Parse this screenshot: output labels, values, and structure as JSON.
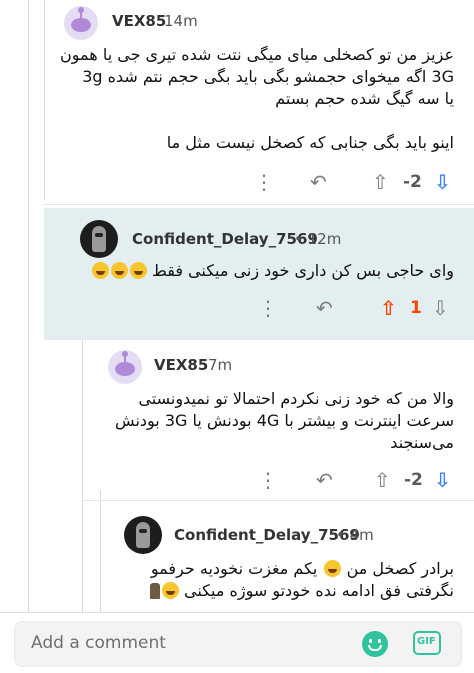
{
  "comments": [
    {
      "username": "VEX85",
      "time": "14m",
      "body_lines": [
        "عزیز من تو کصخلی میای میگی نتت شده تیری جی یا همون",
        "3G اگه میخوای حجمشو بگی باید بگی حجم نتم شده 3g",
        "یا سه گیگ شده حجم بستم",
        "",
        "اینو باید بگی جنابی که کصخل نیست مثل ما"
      ],
      "score": "-2",
      "avatar": "snoo-avatar-purple"
    },
    {
      "username": "Confident_Delay_7569",
      "time": "12m",
      "body_lines": [
        "وای حاجی بس کن داری خود زنی میکنی فقط"
      ],
      "emoji_count": 3,
      "score": "1",
      "highlighted": true,
      "avatar": "dark-ghost-avatar"
    },
    {
      "username": "VEX85",
      "time": "7m",
      "body_lines": [
        "والا من که خود زنی نکردم احتمالا تو نمیدونستی",
        "سرعت اینترنت و بیشتر با 4G بودنش یا 3G بودنش",
        "می‌سنجند"
      ],
      "score": "-2",
      "avatar": "snoo-avatar-purple"
    },
    {
      "username": "Confident_Delay_7569",
      "time": "4m",
      "body_lines": [
        "برادر کصخل من",
        "یکم مغزت نخودیه حرفمو",
        "نگرفتی فق ادامه نده خودتو سوژه میکنی"
      ],
      "avatar": "dark-ghost-avatar"
    }
  ],
  "actions": {
    "more": "⋮",
    "reply": "↶",
    "upvote": "⇧",
    "downvote": "⇩"
  },
  "bottom_bar": {
    "placeholder": "Add a comment",
    "gif_label": "GIF"
  },
  "colors": {
    "upvote_active": "#ff4500",
    "downvote_active": "#3b82f6",
    "highlight_bg": "#e3eef1",
    "accent_green": "#30c39e"
  }
}
